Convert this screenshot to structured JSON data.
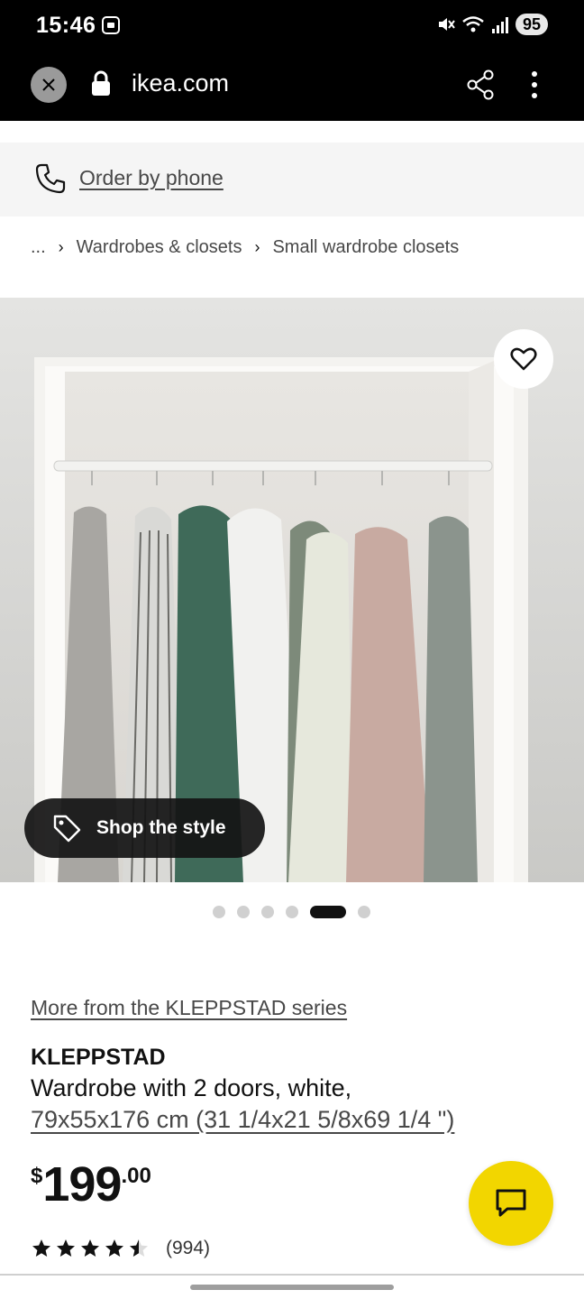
{
  "status_bar": {
    "time": "15:46",
    "battery": "95",
    "icons": [
      "screenshot-icon",
      "mute-icon",
      "wifi-icon",
      "signal-icon"
    ]
  },
  "browser": {
    "url": "ikea.com",
    "icons": [
      "close-icon",
      "lock-icon",
      "share-icon",
      "more-vertical-icon"
    ]
  },
  "order_bar": {
    "label": "Order by phone",
    "icon": "phone-icon"
  },
  "breadcrumb": {
    "items": [
      "...",
      "Wardrobes & closets",
      "Small wardrobe closets"
    ]
  },
  "gallery": {
    "shop_label": "Shop the style",
    "slide_count": 6,
    "active_slide": 5,
    "icons": [
      "heart-icon",
      "tag-icon"
    ]
  },
  "product": {
    "series_link": "More from the KLEPPSTAD series",
    "name": "KLEPPSTAD",
    "description": "Wardrobe with 2 doors, white,",
    "size": "79x55x176 cm (31 1/4x21 5/8x69 1/4 \")",
    "price": {
      "currency": "$",
      "integer": "199",
      "decimal": ".00"
    },
    "rating": {
      "value": 4.5,
      "max": 5,
      "count": "(994)"
    }
  },
  "colors": {
    "chat_button": "#f2d600",
    "top_bar": "#000000",
    "text": "#111111",
    "link_text": "#484848"
  }
}
